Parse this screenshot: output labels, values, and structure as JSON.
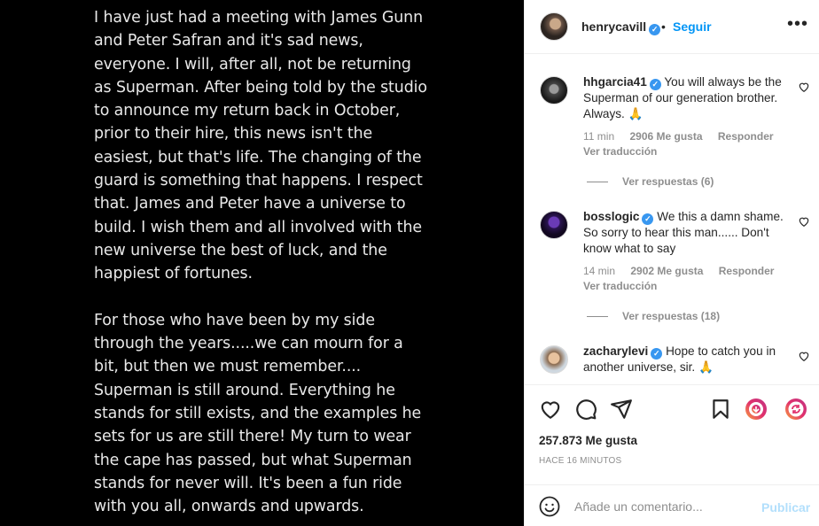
{
  "post": {
    "paragraphs": [
      "I have just had a meeting with James Gunn and Peter Safran and it's sad news, everyone. I will, after all, not be returning as Superman. After being told by the studio to announce my return back in October, prior to their hire, this news isn't the easiest, but that's life. The changing of the guard is something that happens. I respect that. James and Peter have a universe to build. I wish them and all involved with the new universe the best of luck, and the happiest of fortunes.",
      "For those who have been by my side through the years.....we can mourn for a bit, but then we must remember.... Superman is still around. Everything he stands for still exists, and the examples he sets for us are still there! My turn to wear the cape has passed, but what Superman stands for never will. It's been a fun ride with you all, onwards and upwards."
    ]
  },
  "header": {
    "username": "henrycavill",
    "separator": "•",
    "follow_label": "Seguir",
    "more_label": "•••"
  },
  "comments": [
    {
      "username": "hhgarcia41",
      "text": "You will always be the Superman of our generation brother. Always. 🙏",
      "time": "11 min",
      "likes": "2906 Me gusta",
      "reply_label": "Responder",
      "translate_label": "Ver traducción",
      "replies_label": "Ver respuestas (6)"
    },
    {
      "username": "bosslogic",
      "text": "We this a damn shame. So sorry to hear this man...... Don't know what to say",
      "time": "14 min",
      "likes": "2902 Me gusta",
      "reply_label": "Responder",
      "translate_label": "Ver traducción",
      "replies_label": "Ver respuestas (18)"
    },
    {
      "username": "zacharylevi",
      "text": "Hope to catch you in another universe, sir. 🙏"
    }
  ],
  "stats": {
    "likes": "257.873 Me gusta",
    "time_ago": "HACE 16 MINUTOS"
  },
  "add_comment": {
    "placeholder": "Añade un comentario...",
    "publish_label": "Publicar"
  },
  "icons": {
    "verified": "verified-badge-icon",
    "like": "heart-icon",
    "comment": "comment-bubble-icon",
    "share": "paper-plane-icon",
    "save": "bookmark-icon",
    "emoji": "smiley-icon"
  },
  "colors": {
    "accent": "#0095f6",
    "verified": "#3897f0",
    "publish_disabled": "#b2dffc",
    "muted": "#8e8e8e"
  }
}
